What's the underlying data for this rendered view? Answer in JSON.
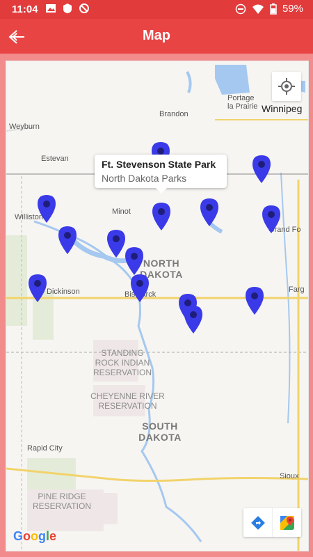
{
  "status": {
    "time": "11:04",
    "battery": "59%"
  },
  "appbar": {
    "title": "Map"
  },
  "map": {
    "callout_title": "Ft. Stevenson State Park",
    "callout_subtitle": "North Dakota Parks",
    "google_logo": "Google",
    "cities": {
      "weyburn": "Weyburn",
      "estevan": "Estevan",
      "brandon": "Brandon",
      "portage": "Portage la Prairie",
      "winnipeg": "Winnipeg",
      "williston": "Williston",
      "minot": "Minot",
      "grand_forks": "Grand Fo",
      "dickinson": "Dickinson",
      "bismarck": "Bismarck",
      "fargo": "Farg",
      "rapid_city": "Rapid City",
      "sioux": "Sioux"
    },
    "regions": {
      "north_dakota": "NORTH DAKOTA",
      "south_dakota": "SOUTH DAKOTA",
      "standing_rock": "STANDING ROCK INDIAN RESERVATION",
      "cheyenne_river": "CHEYENNE RIVER RESERVATION",
      "pine_ridge": "PINE RIDGE RESERVATION"
    },
    "pin_color": "#3a3ae8"
  }
}
